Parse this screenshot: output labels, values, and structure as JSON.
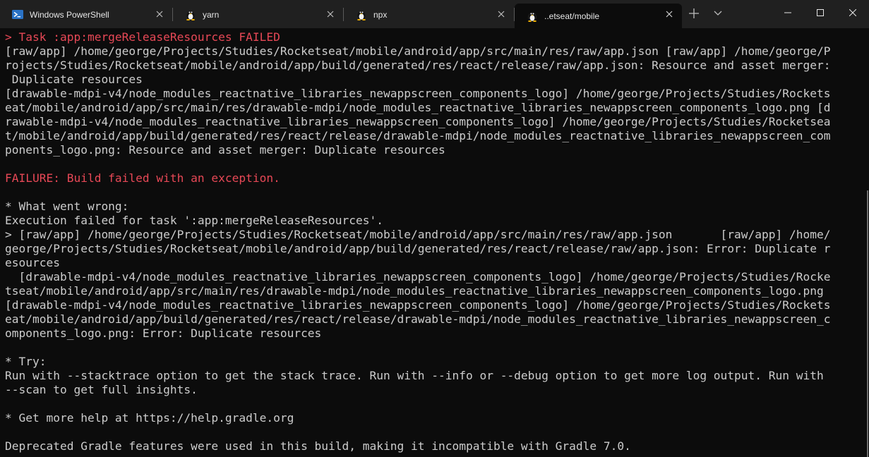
{
  "tabs": [
    {
      "label": "Windows PowerShell",
      "icon": "powershell-icon",
      "active": false
    },
    {
      "label": "yarn",
      "icon": "tux-linux-icon",
      "active": false
    },
    {
      "label": "npx",
      "icon": "tux-linux-icon",
      "active": false
    },
    {
      "label": "..etseat/mobile",
      "icon": "tux-linux-icon",
      "active": true
    }
  ],
  "colors": {
    "background": "#0c0c0c",
    "titlebar": "#202020",
    "foreground": "#cccccc",
    "error": "#e74856",
    "powershell_blue": "#2a72c5"
  },
  "terminal": {
    "lines": [
      {
        "text": "> Task :app:mergeReleaseResources FAILED",
        "color": "red"
      },
      {
        "text": "[raw/app] /home/george/Projects/Studies/Rocketseat/mobile/android/app/src/main/res/raw/app.json [raw/app] /home/george/P",
        "color": "default"
      },
      {
        "text": "rojects/Studies/Rocketseat/mobile/android/app/build/generated/res/react/release/raw/app.json: Resource and asset merger:",
        "color": "default"
      },
      {
        "text": " Duplicate resources",
        "color": "default"
      },
      {
        "text": "[drawable-mdpi-v4/node_modules_reactnative_libraries_newappscreen_components_logo] /home/george/Projects/Studies/Rockets",
        "color": "default"
      },
      {
        "text": "eat/mobile/android/app/src/main/res/drawable-mdpi/node_modules_reactnative_libraries_newappscreen_components_logo.png [d",
        "color": "default"
      },
      {
        "text": "rawable-mdpi-v4/node_modules_reactnative_libraries_newappscreen_components_logo] /home/george/Projects/Studies/Rocketsea",
        "color": "default"
      },
      {
        "text": "t/mobile/android/app/build/generated/res/react/release/drawable-mdpi/node_modules_reactnative_libraries_newappscreen_com",
        "color": "default"
      },
      {
        "text": "ponents_logo.png: Resource and asset merger: Duplicate resources",
        "color": "default"
      },
      {
        "text": "",
        "color": "default"
      },
      {
        "text": "FAILURE: Build failed with an exception.",
        "color": "red"
      },
      {
        "text": "",
        "color": "default"
      },
      {
        "text": "* What went wrong:",
        "color": "default"
      },
      {
        "text": "Execution failed for task ':app:mergeReleaseResources'.",
        "color": "default"
      },
      {
        "text": "> [raw/app] /home/george/Projects/Studies/Rocketseat/mobile/android/app/src/main/res/raw/app.json       [raw/app] /home/",
        "color": "default"
      },
      {
        "text": "george/Projects/Studies/Rocketseat/mobile/android/app/build/generated/res/react/release/raw/app.json: Error: Duplicate r",
        "color": "default"
      },
      {
        "text": "esources",
        "color": "default"
      },
      {
        "text": "  [drawable-mdpi-v4/node_modules_reactnative_libraries_newappscreen_components_logo] /home/george/Projects/Studies/Rocke",
        "color": "default"
      },
      {
        "text": "tseat/mobile/android/app/src/main/res/drawable-mdpi/node_modules_reactnative_libraries_newappscreen_components_logo.png",
        "color": "default"
      },
      {
        "text": "[drawable-mdpi-v4/node_modules_reactnative_libraries_newappscreen_components_logo] /home/george/Projects/Studies/Rockets",
        "color": "default"
      },
      {
        "text": "eat/mobile/android/app/build/generated/res/react/release/drawable-mdpi/node_modules_reactnative_libraries_newappscreen_c",
        "color": "default"
      },
      {
        "text": "omponents_logo.png: Error: Duplicate resources",
        "color": "default"
      },
      {
        "text": "",
        "color": "default"
      },
      {
        "text": "* Try:",
        "color": "default"
      },
      {
        "text": "Run with --stacktrace option to get the stack trace. Run with --info or --debug option to get more log output. Run with",
        "color": "default"
      },
      {
        "text": "--scan to get full insights.",
        "color": "default"
      },
      {
        "text": "",
        "color": "default"
      },
      {
        "text": "* Get more help at https://help.gradle.org",
        "color": "default"
      },
      {
        "text": "",
        "color": "default"
      },
      {
        "text": "Deprecated Gradle features were used in this build, making it incompatible with Gradle 7.0.",
        "color": "default"
      }
    ]
  }
}
